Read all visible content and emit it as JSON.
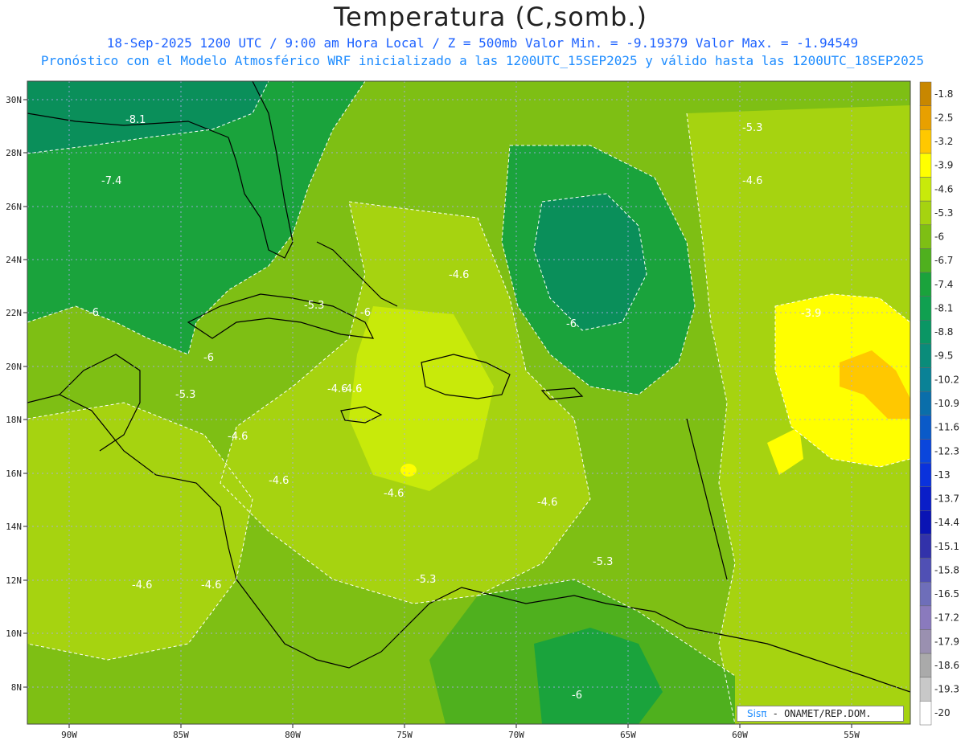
{
  "header": {
    "title": "Temperatura (C,somb.)",
    "subtitle_line1": "18-Sep-2025  1200 UTC / 9:00 am Hora Local / Z = 500mb  Valor Min. = -9.19379  Valor Max. = -1.94549",
    "subtitle_line2": "Pronóstico con el Modelo Atmosférico WRF inicializado a las 1200UTC_15SEP2025 y válido hasta las  1200UTC_18SEP2025"
  },
  "map": {
    "lon_labels": [
      "90W",
      "85W",
      "80W",
      "75W",
      "70W",
      "65W",
      "60W",
      "55W"
    ],
    "lat_labels": [
      "30N",
      "28N",
      "26N",
      "24N",
      "22N",
      "20N",
      "18N",
      "16N",
      "14N",
      "12N",
      "10N",
      "8N"
    ],
    "contour_labels": [
      "-8.1",
      "-7.4",
      "-6",
      "-6",
      "-6",
      "-6",
      "-6",
      "-5.3",
      "-5.3",
      "-5.3",
      "-5.3",
      "-5.3",
      "-4.6",
      "-4.6",
      "-4.6",
      "-4.6",
      "-4.6",
      "-4.6",
      "-4.6",
      "-4.6",
      "-4.6",
      "-4.6",
      "-3.9"
    ],
    "colors": {
      "very_dark": "#0a8f5a",
      "dark": "#1aa33c",
      "mid_dark": "#4fb01e",
      "mid": "#7ebf14",
      "light": "#a6d310",
      "lighter": "#c8ea0a",
      "yellow": "#ffff00",
      "orange": "#ffc800"
    }
  },
  "colorbar": {
    "labels": [
      "-1.8",
      "-2.5",
      "-3.2",
      "-3.9",
      "-4.6",
      "-5.3",
      "-6",
      "-6.7",
      "-7.4",
      "-8.1",
      "-8.8",
      "-9.5",
      "-10.2",
      "-10.9",
      "-11.6",
      "-12.3",
      "-13",
      "-13.7",
      "-14.4",
      "-15.1",
      "-15.8",
      "-16.5",
      "-17.2",
      "-17.9",
      "-18.6",
      "-19.3",
      "-20"
    ],
    "colors": [
      "#c88700",
      "#e8a000",
      "#ffc800",
      "#ffff00",
      "#c8ea0a",
      "#a6d310",
      "#7ebf14",
      "#4fb01e",
      "#1aa33c",
      "#10a050",
      "#0a9664",
      "#0a8c7a",
      "#0a8296",
      "#0a6eaa",
      "#0a5ac8",
      "#0a46dc",
      "#0a32dc",
      "#0a1ec8",
      "#0a14b4",
      "#3232aa",
      "#5050b4",
      "#6e6eb9",
      "#8a7abd",
      "#9a90b0",
      "#aaaaaa",
      "#c8c8c8",
      "#ffffff"
    ]
  },
  "credit": {
    "logo": "Sisπ",
    "text": "- ONAMET/REP.DOM."
  }
}
